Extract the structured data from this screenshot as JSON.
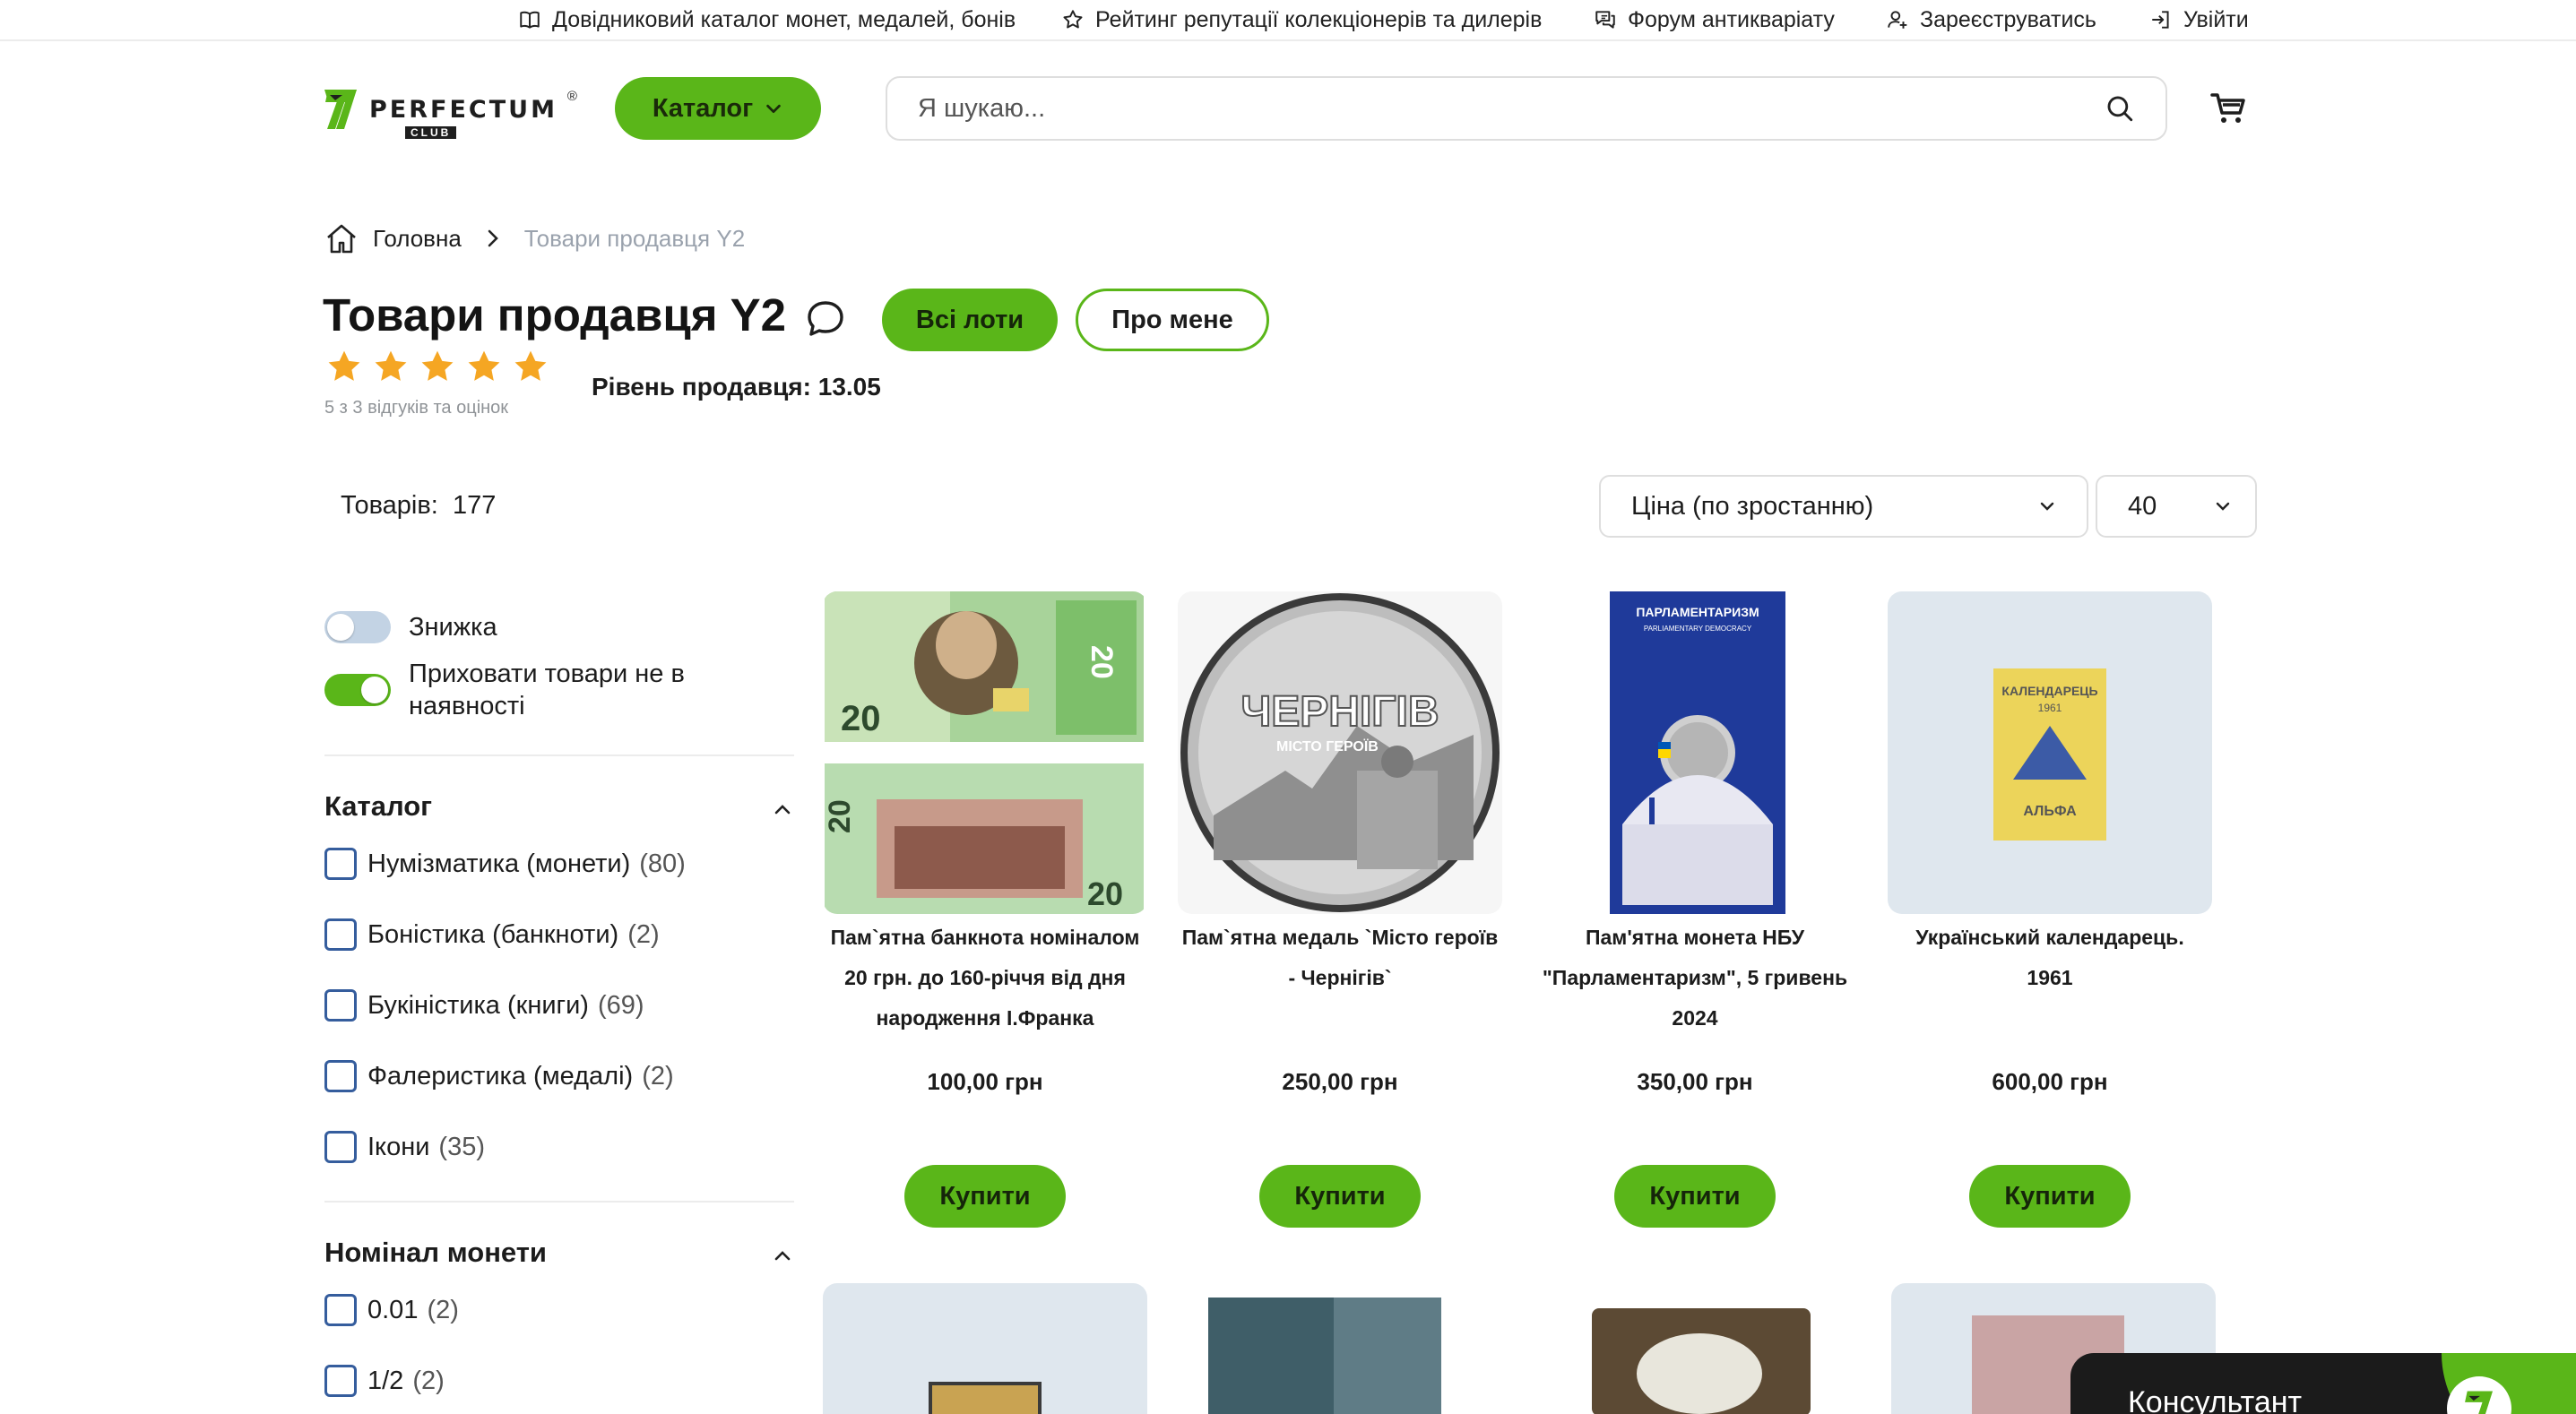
{
  "topbar": {
    "links": [
      {
        "label": "Довідниковий каталог монет, медалей, бонів",
        "icon": "book-icon"
      },
      {
        "label": "Рейтинг репутації колекціонерів та дилерів",
        "icon": "star-outline-icon"
      },
      {
        "label": "Форум антикваріату",
        "icon": "forum-icon"
      },
      {
        "label": "Зареєструватись",
        "icon": "user-add-icon"
      },
      {
        "label": "Увійти",
        "icon": "login-icon"
      }
    ]
  },
  "header": {
    "logo_name": "PERFECTUM",
    "logo_sub": "CLUB",
    "logo_reg": "®",
    "catalog_label": "Каталог",
    "search_placeholder": "Я шукаю..."
  },
  "breadcrumb": {
    "home": "Головна",
    "current": "Товари продавця Y2"
  },
  "seller": {
    "title": "Товари продавця Y2",
    "all_lots_label": "Всі лоти",
    "about_label": "Про мене",
    "rating_stars": 5,
    "reviews_text": "5 з 3 відгуків та оцінок",
    "level_label": "Рівень продавця:",
    "level_value": "13.05"
  },
  "listing": {
    "count_label": "Товарів:",
    "count_value": "177",
    "sort_value": "Ціна (по зростанню)",
    "per_page_value": "40"
  },
  "filters": {
    "discount_label": "Знижка",
    "discount_on": false,
    "hide_unavailable_label_1": "Приховати товари не в",
    "hide_unavailable_label_2": "наявності",
    "hide_unavailable_on": true,
    "catalog_title": "Каталог",
    "catalog_items": [
      {
        "label": "Нумізматика (монети)",
        "count": "(80)"
      },
      {
        "label": "Боністика (банкноти)",
        "count": "(2)"
      },
      {
        "label": "Букіністика (книги)",
        "count": "(69)"
      },
      {
        "label": "Фалеристика (медалі)",
        "count": "(2)"
      },
      {
        "label": "Ікони",
        "count": "(35)"
      }
    ],
    "nominal_title": "Номінал монети",
    "nominal_items": [
      {
        "label": "0.01",
        "count": "(2)"
      },
      {
        "label": "1/2",
        "count": "(2)"
      }
    ]
  },
  "products": [
    {
      "name": [
        "Пам`ятна банкнота номіналом",
        "20 грн. до 160-річчя від дня",
        "народження І.Франка"
      ],
      "price": "100,00 грн",
      "buy_label": "Купити"
    },
    {
      "name": [
        "Пам`ятна медаль `Місто героїв",
        "- Чернігів`"
      ],
      "price": "250,00 грн",
      "buy_label": "Купити",
      "image_text": "ЧЕРНІГІВ",
      "image_subtext": "МІСТО ГЕРОЇВ"
    },
    {
      "name": [
        "Пам'ятна монета НБУ",
        "\"Парламентаризм\", 5 гривень",
        "2024"
      ],
      "price": "350,00 грн",
      "buy_label": "Купити",
      "image_text": "ПАРЛАМЕНТАРИЗМ",
      "image_subtext": "PARLIAMENTARY DEMOCRACY"
    },
    {
      "name": [
        "Український календарець.",
        "1961"
      ],
      "price": "600,00 грн",
      "buy_label": "Купити",
      "image_text": "КАЛЕНДАРЕЦЬ",
      "image_year": "1961",
      "image_sub": "АЛЬФА"
    }
  ],
  "consultant": {
    "label": "Консультант"
  },
  "colors": {
    "accent": "#5ab619",
    "text": "#1c1c1c",
    "muted": "#9aa2ad",
    "checkbox_border": "#355d9d"
  }
}
